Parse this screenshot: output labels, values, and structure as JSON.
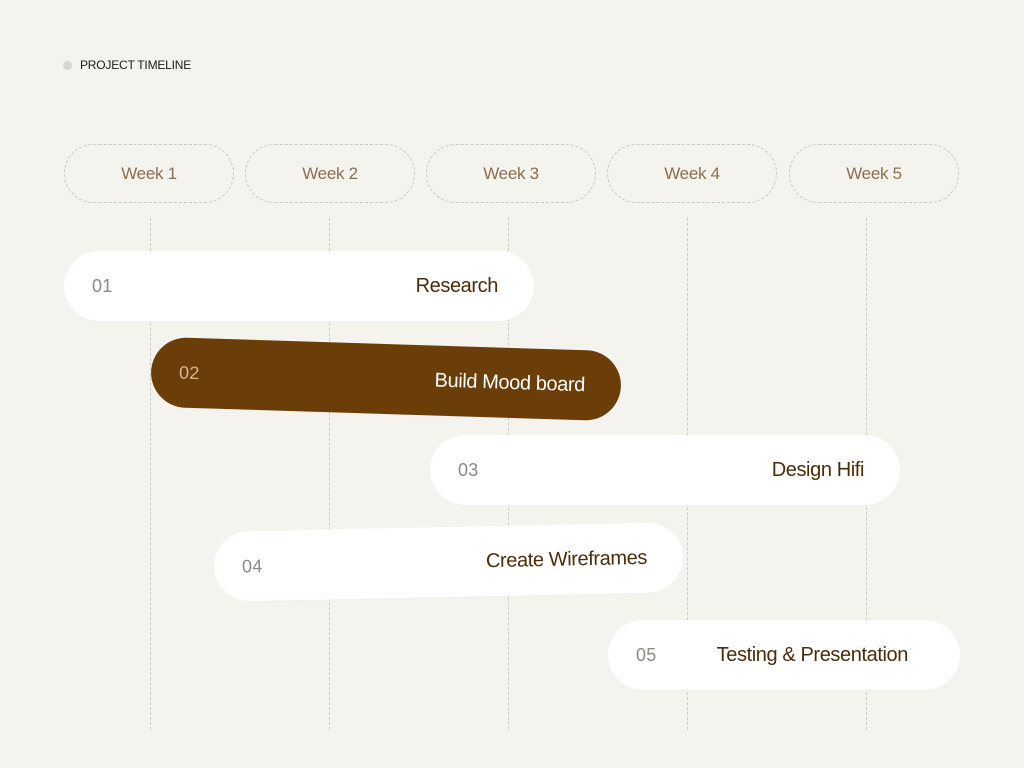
{
  "header": {
    "title": "PROJECT TIMELINE"
  },
  "weeks": [
    "Week 1",
    "Week 2",
    "Week 3",
    "Week 4",
    "Week 5"
  ],
  "tasks": [
    {
      "number": "01",
      "label": "Research"
    },
    {
      "number": "02",
      "label": "Build Mood board"
    },
    {
      "number": "03",
      "label": "Design Hifi"
    },
    {
      "number": "04",
      "label": "Create Wireframes"
    },
    {
      "number": "05",
      "label": "Testing & Presentation"
    }
  ],
  "colors": {
    "background": "#f5f3ee",
    "accent": "#6b3e09",
    "week_text": "#8a6f4d",
    "task_text": "#4a2c08",
    "number_text": "#8d8a85"
  }
}
